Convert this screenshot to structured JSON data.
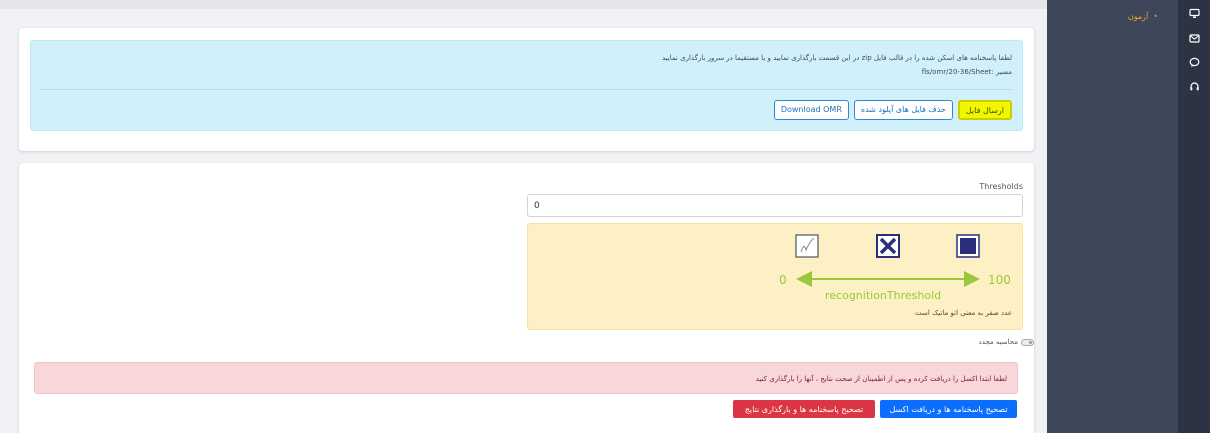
{
  "sidebar": {
    "menu_item": "آزمون",
    "icons": [
      "monitor-icon",
      "envelope-icon",
      "chat-icon",
      "headset-icon"
    ]
  },
  "upload_card": {
    "instruction": "لطفا پاسخنامه های اسکن شده را در قالب فایل zip در این قسمت بارگذاری نمایید و یا مستقیما در سرور بارگذاری نمایید",
    "path": "مسیر :fls/omr/20-36/Sheet",
    "buttons": {
      "send_file": "ارسال فایل",
      "delete_uploaded": "حذف فایل های آپلود شده",
      "download_omr": "Download OMR"
    }
  },
  "threshold_card": {
    "label": "Thresholds",
    "input_value": "0",
    "diagram": {
      "min_label": "0",
      "max_label": "100",
      "caption": "recognitionThreshold"
    },
    "note": "عدد صفر به معنی اتو ماتیک است",
    "recalc_label": "محاسبه مجدد",
    "alert": "لطفا ابتدا اکسل را دریافت کرده و پس از اطمینان از صحت نتایج ، آنها را بارگذاری کنید",
    "btn_correct_excel": "تصحیح پاسخنامه ها و دریافت اکسل",
    "btn_correct_upload": "تصحیح پاسخنامه ها و بارگذاری نتایج"
  },
  "colors": {
    "sidebar": "#3d4759",
    "icon_strip": "#2c3444",
    "accent_menu": "#f0a830",
    "info_bg": "#d1f0fa",
    "warning_bg": "#fdf0c5",
    "danger_bg": "#f8d7da",
    "primary": "#0d6efd",
    "danger": "#dc3545",
    "highlight": "#f2f700",
    "diagram_green": "#9bc83a",
    "diagram_navy": "#2b2f7a"
  }
}
